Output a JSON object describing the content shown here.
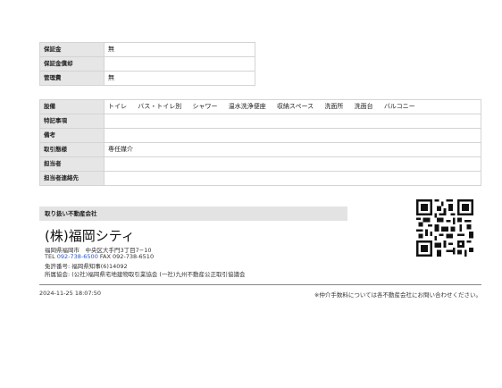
{
  "top_table": [
    {
      "label": "保証金",
      "value": "無"
    },
    {
      "label": "保証金償却",
      "value": ""
    },
    {
      "label": "管理費",
      "value": "無"
    }
  ],
  "details_table": {
    "equipment": {
      "label": "設備",
      "items": [
        "トイレ",
        "バス・トイレ別",
        "シャワー",
        "温水洗浄便座",
        "収納スペース",
        "洗面所",
        "洗面台",
        "バルコニー"
      ]
    },
    "rows": [
      {
        "label": "特記事項",
        "value": ""
      },
      {
        "label": "備考",
        "value": ""
      },
      {
        "label": "取引態様",
        "value": "専任媒介"
      },
      {
        "label": "担当者",
        "value": ""
      },
      {
        "label": "担当者連絡先",
        "value": ""
      }
    ]
  },
  "agent": {
    "section_label": "取り扱い不動産会社",
    "company_name": "(株)福岡シティ",
    "address": "福岡県福岡市　中央区大手門3丁目7−10",
    "tel_label": "TEL",
    "tel": "092-738-6500",
    "fax_label": "FAX",
    "fax": "092-738-6510",
    "license": "免許番号: 福岡県知事(6)14092",
    "associations": "所属協会: (公社)福岡県宅地建物取引業協会 (一社)九州不動産公正取引協議会"
  },
  "qr_icon": "qr-code-icon",
  "footer": {
    "timestamp": "2024-11-25 18:07:50",
    "note": "※仲介手数料については各不動産会社にお問い合わせください。"
  }
}
